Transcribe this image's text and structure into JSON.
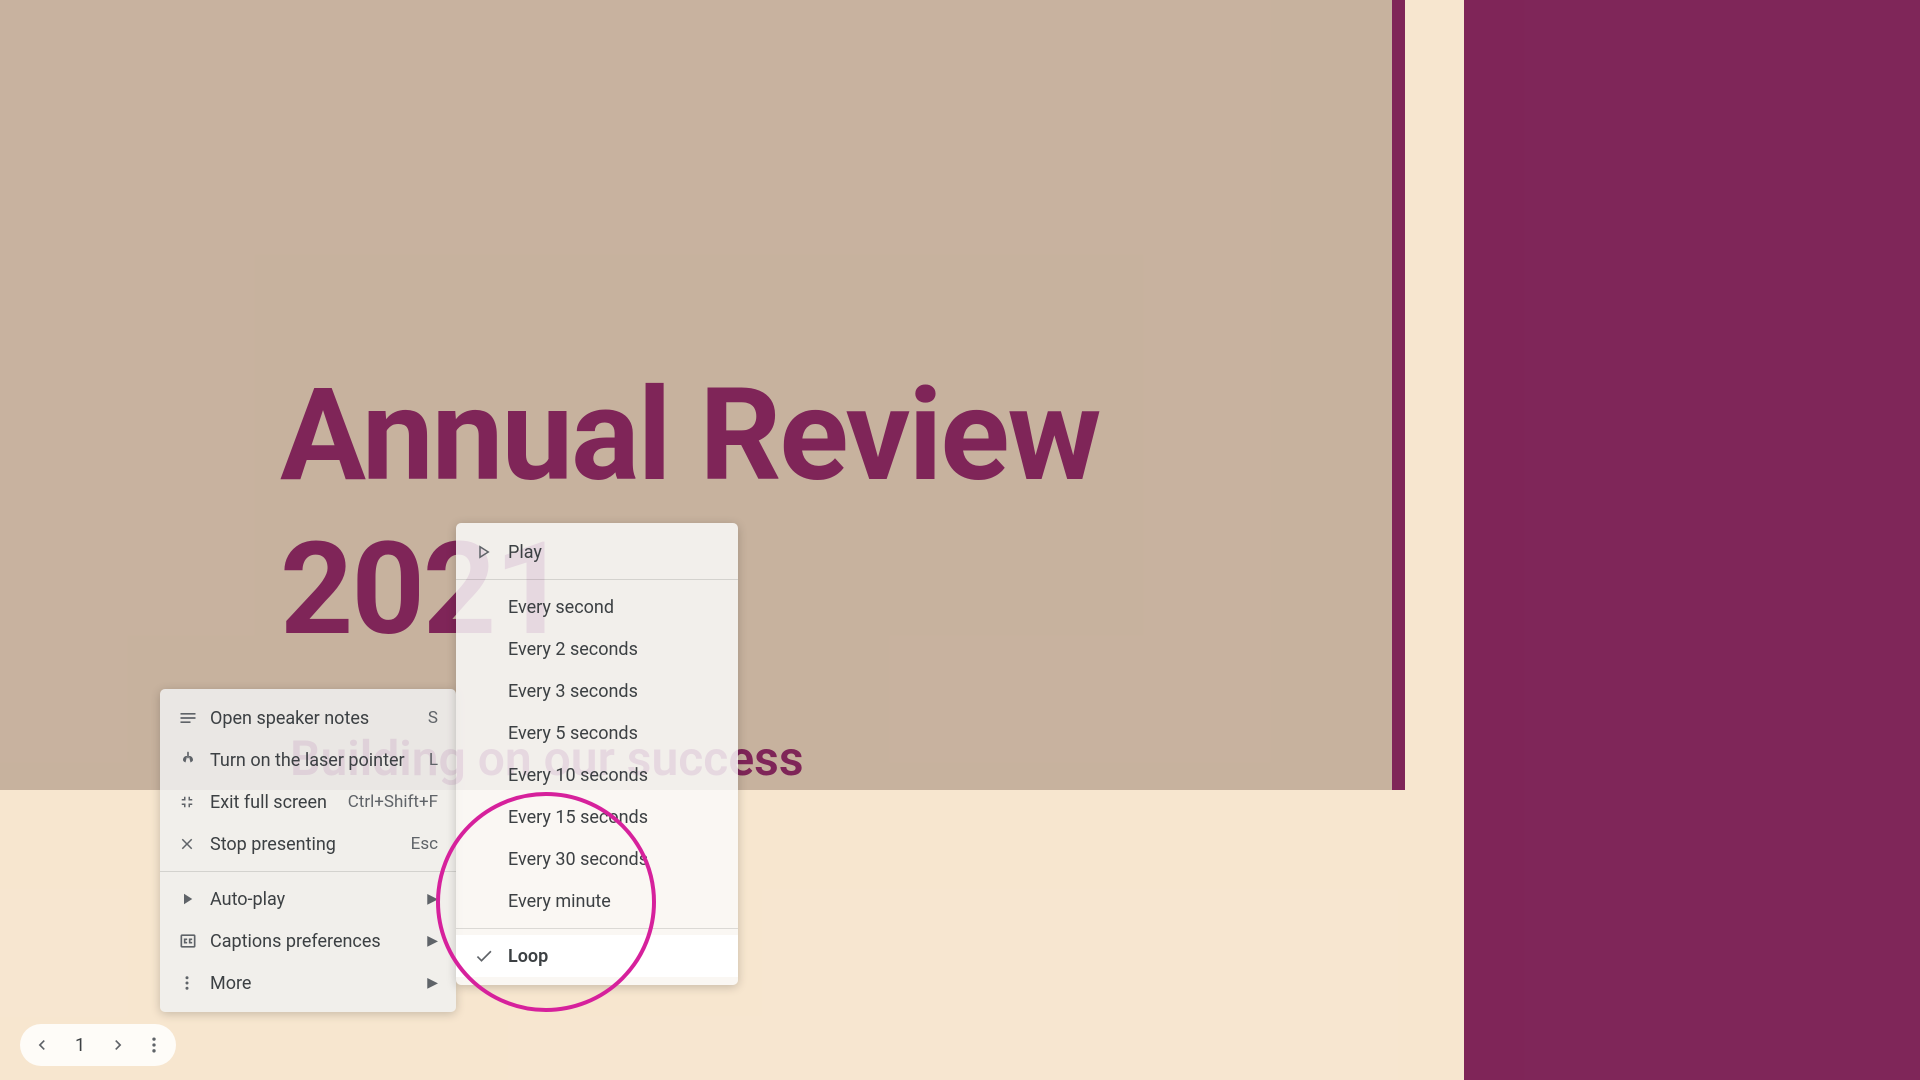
{
  "slide": {
    "title_line1": "Annual Review",
    "title_line2": "2021",
    "subtitle": "Building on our success"
  },
  "toolbar": {
    "slide_number": "1"
  },
  "context_menu": {
    "items": [
      {
        "label": "Open speaker notes",
        "shortcut": "S"
      },
      {
        "label": "Turn on the laser pointer",
        "shortcut": "L"
      },
      {
        "label": "Exit full screen",
        "shortcut": "Ctrl+Shift+F"
      },
      {
        "label": "Stop presenting",
        "shortcut": "Esc"
      }
    ],
    "submenu_items": [
      {
        "label": "Auto-play"
      },
      {
        "label": "Captions preferences"
      },
      {
        "label": "More"
      }
    ]
  },
  "autoplay_submenu": {
    "play": "Play",
    "intervals": [
      "Every second",
      "Every 2 seconds",
      "Every 3 seconds",
      "Every 5 seconds",
      "Every 10 seconds",
      "Every 15 seconds",
      "Every 30 seconds",
      "Every minute"
    ],
    "loop": "Loop"
  }
}
